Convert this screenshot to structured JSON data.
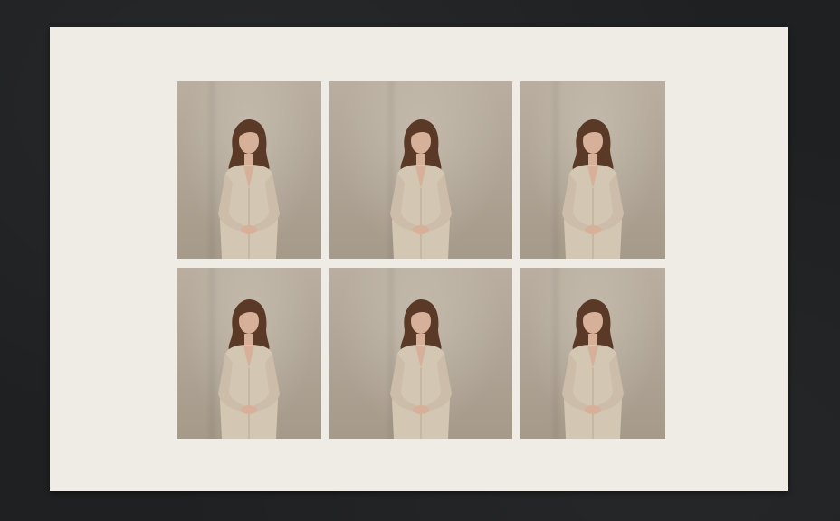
{
  "scene": {
    "description_colors": {
      "background": "#1f2022",
      "paper": "#efece6",
      "backdrop": "#b0a596",
      "garment": "#d3c6b3",
      "hair": "#5a3a26",
      "skin": "#d7b09a"
    }
  },
  "contact_sheet": {
    "photos": [
      {
        "id": "portrait-1"
      },
      {
        "id": "portrait-2"
      },
      {
        "id": "portrait-3"
      },
      {
        "id": "portrait-4"
      },
      {
        "id": "portrait-5"
      },
      {
        "id": "portrait-6"
      }
    ]
  }
}
